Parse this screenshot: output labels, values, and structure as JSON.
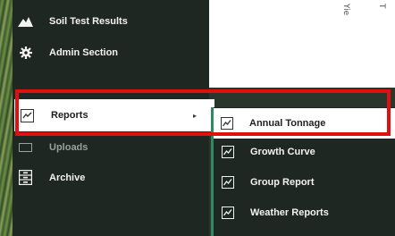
{
  "sidebar": {
    "items": [
      {
        "label": "Soil Test Results",
        "icon": "mountain-icon"
      },
      {
        "label": "Admin Section",
        "icon": "gear-icon"
      },
      {
        "label": "Reports",
        "icon": "report-icon"
      },
      {
        "label": "Uploads",
        "icon": "upload-icon"
      },
      {
        "label": "Archive",
        "icon": "archive-icon"
      }
    ]
  },
  "reports_caret": "▸",
  "submenu": {
    "items": [
      {
        "label": "Annual Tonnage",
        "icon": "chart-icon"
      },
      {
        "label": "Growth Curve",
        "icon": "chart-icon"
      },
      {
        "label": "Group Report",
        "icon": "chart-icon"
      },
      {
        "label": "Weather Reports",
        "icon": "chart-icon"
      }
    ]
  },
  "content_ticks": [
    "Yie",
    "T"
  ],
  "colors": {
    "highlight": "#e01010",
    "sidebar": "#1f2722",
    "accent": "#2f8a63"
  }
}
